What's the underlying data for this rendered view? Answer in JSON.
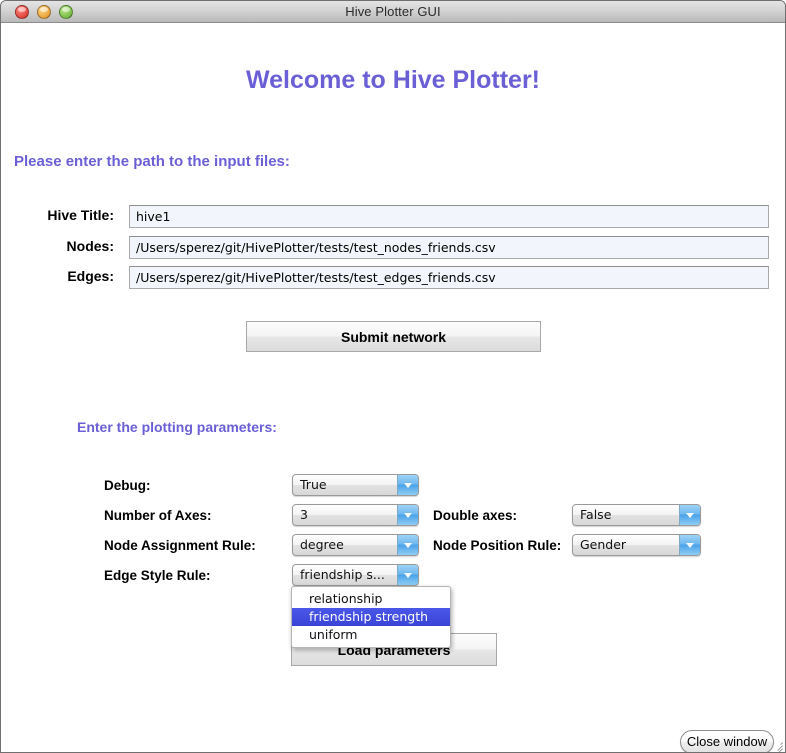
{
  "window": {
    "title": "Hive Plotter GUI",
    "traffic_lights": [
      "close-light",
      "minimize-light",
      "zoom-light"
    ]
  },
  "headings": {
    "welcome": "Welcome to Hive Plotter!",
    "paths_prompt": "Please enter the path to the input files:",
    "params_prompt": "Enter the plotting parameters:"
  },
  "path_fields": [
    {
      "label": "Hive Title:",
      "value": "hive1",
      "name": "hive-title"
    },
    {
      "label": "Nodes:",
      "value": "/Users/sperez/git/HivePlotter/tests/test_nodes_friends.csv",
      "name": "nodes-path"
    },
    {
      "label": "Edges:",
      "value": "/Users/sperez/git/HivePlotter/tests/test_edges_friends.csv",
      "name": "edges-path"
    }
  ],
  "buttons": {
    "submit_network": "Submit network",
    "load_parameters": "Load parameters",
    "close_window": "Close window"
  },
  "parameters": {
    "left": [
      {
        "label": "Debug:",
        "value": "True",
        "name": "debug"
      },
      {
        "label": "Number of Axes:",
        "value": "3",
        "name": "number-of-axes"
      },
      {
        "label": "Node Assignment Rule:",
        "value": "degree",
        "name": "node-assignment-rule"
      },
      {
        "label": "Edge Style Rule:",
        "value": "friendship s...",
        "name": "edge-style-rule"
      }
    ],
    "right": [
      {
        "label": "Double axes:",
        "value": "False",
        "name": "double-axes"
      },
      {
        "label": "Node Position Rule:",
        "value": "Gender",
        "name": "node-position-rule"
      }
    ]
  },
  "open_menu": {
    "owner": "edge-style-rule",
    "items": [
      {
        "label": "relationship",
        "selected": false
      },
      {
        "label": "friendship strength",
        "selected": true
      },
      {
        "label": "uniform",
        "selected": false
      }
    ]
  },
  "colors": {
    "heading": "#6b5fd6",
    "menu_highlight": "#3a45d8",
    "field_background": "#f2f6fc",
    "titlebar": "#d3d3d3"
  }
}
